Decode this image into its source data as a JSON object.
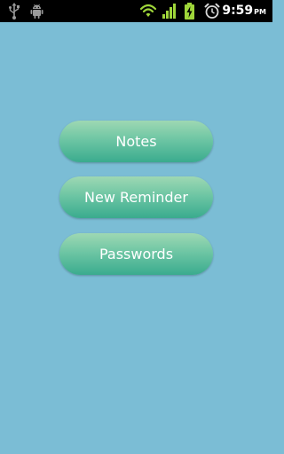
{
  "status_bar": {
    "time": "9:59",
    "ampm": "PM",
    "icons": [
      "usb-icon",
      "android-icon",
      "wifi-icon",
      "signal-icon",
      "battery-charging-icon",
      "alarm-icon"
    ]
  },
  "menu": {
    "items": [
      {
        "label": "Notes"
      },
      {
        "label": "New Reminder"
      },
      {
        "label": "Passwords"
      }
    ]
  },
  "colors": {
    "background": "#7bbdd5",
    "button_top": "#9ed8b3",
    "button_bottom": "#3aab8e",
    "battery": "#9fd63a"
  }
}
